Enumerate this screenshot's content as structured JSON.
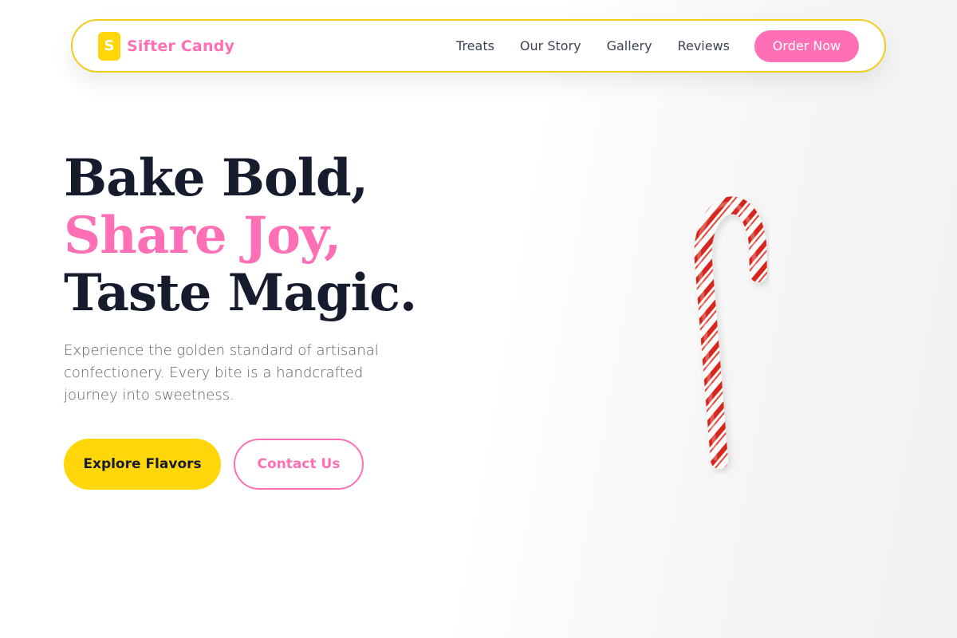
{
  "brand": {
    "logo_letter": "S",
    "name": "Sifter Candy"
  },
  "nav": {
    "items": [
      {
        "label": "Treats"
      },
      {
        "label": "Our Story"
      },
      {
        "label": "Gallery"
      },
      {
        "label": "Reviews"
      }
    ],
    "cta_label": "Order Now"
  },
  "hero": {
    "title_line1": "Bake Bold,",
    "title_line2": "Share Joy,",
    "title_line3": "Taste Magic.",
    "description": "Experience the golden standard of artisanal confectionery. Every bite is a handcrafted journey into sweetness.",
    "primary_button": "Explore Flavors",
    "secondary_button": "Contact Us",
    "image_icon": "candy-cane-icon"
  },
  "colors": {
    "brand_pink": "#ff6fb5",
    "brand_yellow": "#ffd60a",
    "heading_dark": "#161b2e",
    "body_gray": "#5a606c"
  }
}
